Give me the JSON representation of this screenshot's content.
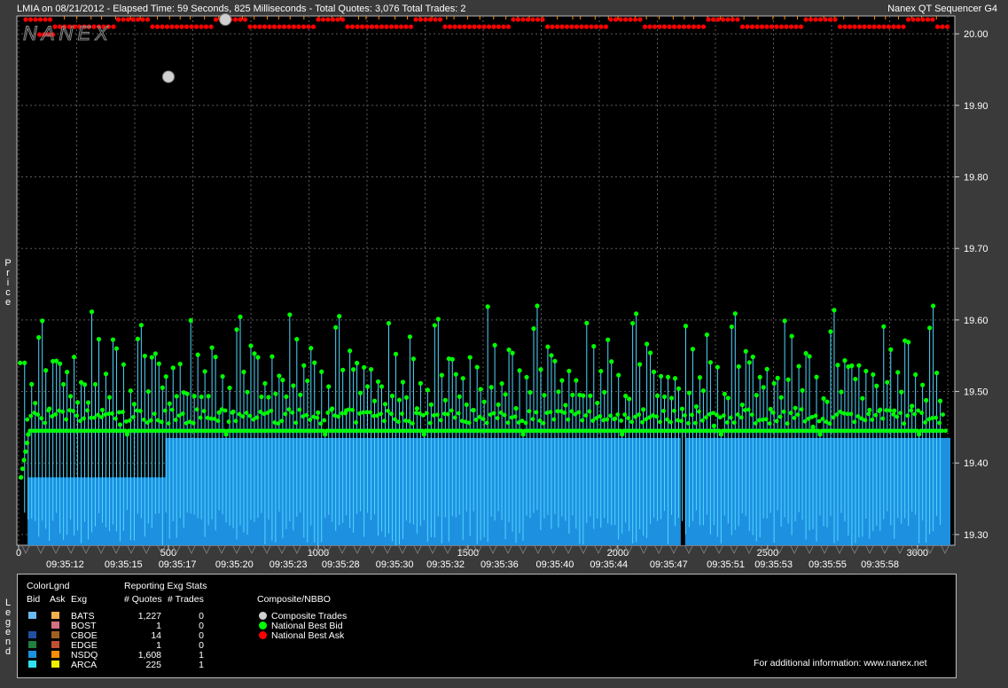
{
  "header": {
    "title": "LMIA on 08/21/2012  -  Elapsed Time: 59 Seconds, 825 Milliseconds  -  Total Quotes: 3,076  Total Trades: 2",
    "app_name": "Nanex QT Sequencer G4",
    "logo_text": "NANEX"
  },
  "side_labels": {
    "price": "Price",
    "legend": "Legend"
  },
  "colors": {
    "background": "#000000",
    "grid": "#5a5a5a",
    "bid_fill": "#1e90e0",
    "bid_line": "#4fd8ff",
    "bid_dot": "#00ff00",
    "ask_dot": "#ff0000",
    "ask_line": "#ff8c00",
    "trade_dot": "#d0d0d0"
  },
  "chart_data": {
    "type": "line",
    "ylim": [
      19.285,
      20.025
    ],
    "xlim": [
      0,
      3110
    ],
    "y_ticks": [
      "20.00",
      "19.90",
      "19.80",
      "19.70",
      "19.60",
      "19.50",
      "19.40",
      "19.30"
    ],
    "y_tick_values": [
      20.0,
      19.9,
      19.8,
      19.7,
      19.6,
      19.5,
      19.4,
      19.3
    ],
    "x_ticks": [
      "0",
      "500",
      "1000",
      "1500",
      "2000",
      "2500",
      "3000"
    ],
    "x_tick_values": [
      0,
      500,
      1000,
      1500,
      2000,
      2500,
      3000
    ],
    "time_labels": [
      "09:35:12",
      "09:35:15",
      "09:35:17",
      "09:35:20",
      "09:35:23",
      "09:35:28",
      "09:35:30",
      "09:35:32",
      "09:35:36",
      "09:35:40",
      "09:35:44",
      "09:35:47",
      "09:35:51",
      "09:35:53",
      "09:35:55",
      "09:35:58"
    ],
    "time_label_positions": [
      155,
      350,
      530,
      720,
      900,
      1075,
      1255,
      1425,
      1605,
      1790,
      1970,
      2170,
      2360,
      2520,
      2700,
      2875
    ],
    "series": [
      {
        "name": "National Best Bid",
        "base": 19.435,
        "spikes": [
          19.54,
          19.38,
          19.52,
          19.5,
          19.6,
          19.62,
          19.55,
          19.5,
          19.57,
          19.56,
          19.55,
          19.52,
          19.54,
          19.51,
          19.55,
          19.5,
          19.54,
          19.52,
          19.5,
          19.62,
          19.52,
          19.58,
          19.5,
          19.54,
          19.52,
          19.58,
          19.57,
          19.48
        ]
      },
      {
        "name": "National Best Ask",
        "base": 20.01,
        "alt": 20.02
      },
      {
        "name": "Composite Trades",
        "values": [
          [
            500,
            19.94
          ],
          [
            690,
            20.02
          ]
        ]
      }
    ]
  },
  "legend": {
    "col_headers": {
      "colorlgnd": "ColorLgnd",
      "bid": "Bid",
      "ask": "Ask",
      "exg": "Exg"
    },
    "stats_title": "Reporting Exg Stats",
    "quotes_header": "# Quotes",
    "trades_header": "# Trades",
    "rows": [
      {
        "exg": "BATS",
        "quotes": "1,227",
        "trades": "0",
        "bid_color": "#6cb8f0",
        "ask_color": "#f0b050"
      },
      {
        "exg": "BOST",
        "quotes": "1",
        "trades": "0",
        "bid_color": "#000000",
        "ask_color": "#d07080"
      },
      {
        "exg": "CBOE",
        "quotes": "14",
        "trades": "0",
        "bid_color": "#2050a0",
        "ask_color": "#a06020"
      },
      {
        "exg": "EDGE",
        "quotes": "1",
        "trades": "0",
        "bid_color": "#208040",
        "ask_color": "#c05030"
      },
      {
        "exg": "NSDQ",
        "quotes": "1,608",
        "trades": "1",
        "bid_color": "#1e90e0",
        "ask_color": "#ff8c00"
      },
      {
        "exg": "ARCA",
        "quotes": "225",
        "trades": "1",
        "bid_color": "#30e0f0",
        "ask_color": "#f0f000"
      }
    ],
    "composite_title": "Composite/NBBO",
    "composite_items": [
      {
        "label": "Composite Trades",
        "color": "#d0d0d0"
      },
      {
        "label": "National Best Bid",
        "color": "#00ff00"
      },
      {
        "label": "National Best Ask",
        "color": "#ff0000"
      }
    ],
    "footer": "For additional information: www.nanex.net"
  }
}
